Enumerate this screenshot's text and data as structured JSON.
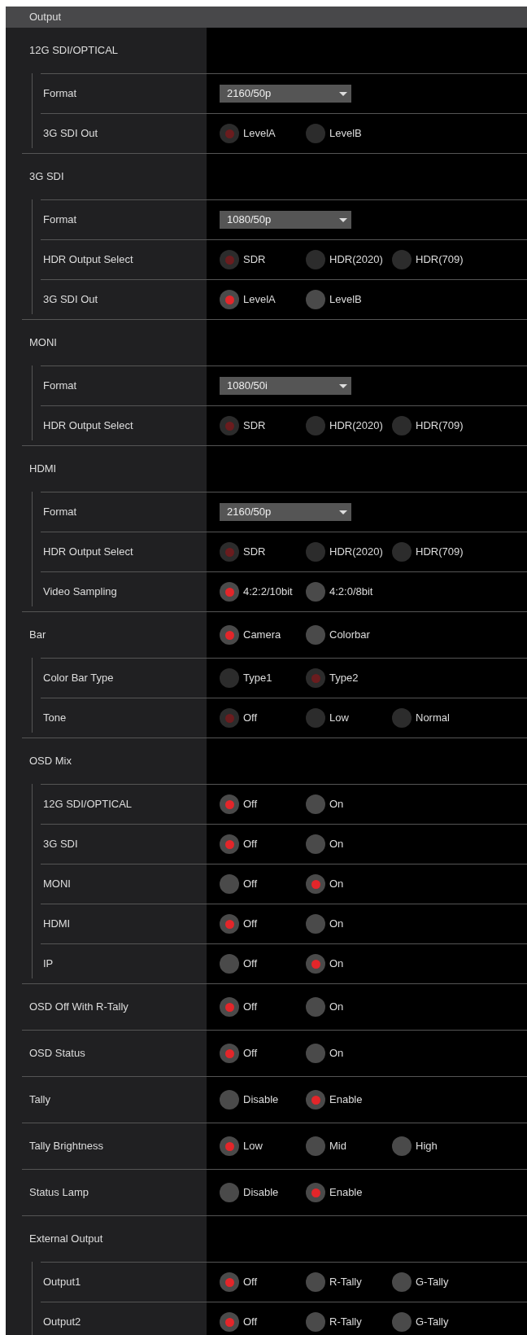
{
  "panel_title": "Output",
  "rows": [
    {
      "kind": "group",
      "label": "12G SDI/OPTICAL",
      "children": [
        {
          "kind": "select",
          "label": "Format",
          "value": "2160/50p"
        },
        {
          "kind": "radio",
          "label": "3G SDI Out",
          "disabled": true,
          "options": [
            {
              "label": "LevelA",
              "selected": true
            },
            {
              "label": "LevelB",
              "selected": false
            }
          ]
        }
      ]
    },
    {
      "kind": "group",
      "label": "3G SDI",
      "children": [
        {
          "kind": "select",
          "label": "Format",
          "value": "1080/50p"
        },
        {
          "kind": "radio",
          "label": "HDR Output Select",
          "disabled": true,
          "options": [
            {
              "label": "SDR",
              "selected": true
            },
            {
              "label": "HDR(2020)",
              "selected": false
            },
            {
              "label": "HDR(709)",
              "selected": false
            }
          ]
        },
        {
          "kind": "radio",
          "label": "3G SDI Out",
          "disabled": false,
          "options": [
            {
              "label": "LevelA",
              "selected": true
            },
            {
              "label": "LevelB",
              "selected": false
            }
          ]
        }
      ]
    },
    {
      "kind": "group",
      "label": "MONI",
      "children": [
        {
          "kind": "select",
          "label": "Format",
          "value": "1080/50i"
        },
        {
          "kind": "radio",
          "label": "HDR Output Select",
          "disabled": true,
          "options": [
            {
              "label": "SDR",
              "selected": true
            },
            {
              "label": "HDR(2020)",
              "selected": false
            },
            {
              "label": "HDR(709)",
              "selected": false
            }
          ]
        }
      ]
    },
    {
      "kind": "group",
      "label": "HDMI",
      "children": [
        {
          "kind": "select",
          "label": "Format",
          "value": "2160/50p"
        },
        {
          "kind": "radio",
          "label": "HDR Output Select",
          "disabled": true,
          "options": [
            {
              "label": "SDR",
              "selected": true
            },
            {
              "label": "HDR(2020)",
              "selected": false
            },
            {
              "label": "HDR(709)",
              "selected": false
            }
          ]
        },
        {
          "kind": "radio",
          "label": "Video Sampling",
          "disabled": false,
          "options": [
            {
              "label": "4:2:2/10bit",
              "selected": true
            },
            {
              "label": "4:2:0/8bit",
              "selected": false
            }
          ]
        }
      ]
    },
    {
      "kind": "group",
      "label": "Bar",
      "disabled": false,
      "options": [
        {
          "label": "Camera",
          "selected": true
        },
        {
          "label": "Colorbar",
          "selected": false
        }
      ],
      "children": [
        {
          "kind": "radio",
          "label": "Color Bar Type",
          "disabled": true,
          "options": [
            {
              "label": "Type1",
              "selected": false
            },
            {
              "label": "Type2",
              "selected": true
            }
          ]
        },
        {
          "kind": "radio",
          "label": "Tone",
          "disabled": true,
          "options": [
            {
              "label": "Off",
              "selected": true
            },
            {
              "label": "Low",
              "selected": false
            },
            {
              "label": "Normal",
              "selected": false
            }
          ]
        }
      ]
    },
    {
      "kind": "group",
      "label": "OSD Mix",
      "children": [
        {
          "kind": "radio",
          "label": "12G SDI/OPTICAL",
          "disabled": false,
          "options": [
            {
              "label": "Off",
              "selected": true
            },
            {
              "label": "On",
              "selected": false
            }
          ]
        },
        {
          "kind": "radio",
          "label": "3G SDI",
          "disabled": false,
          "options": [
            {
              "label": "Off",
              "selected": true
            },
            {
              "label": "On",
              "selected": false
            }
          ]
        },
        {
          "kind": "radio",
          "label": "MONI",
          "disabled": false,
          "options": [
            {
              "label": "Off",
              "selected": false
            },
            {
              "label": "On",
              "selected": true
            }
          ]
        },
        {
          "kind": "radio",
          "label": "HDMI",
          "disabled": false,
          "options": [
            {
              "label": "Off",
              "selected": true
            },
            {
              "label": "On",
              "selected": false
            }
          ]
        },
        {
          "kind": "radio",
          "label": "IP",
          "disabled": false,
          "options": [
            {
              "label": "Off",
              "selected": false
            },
            {
              "label": "On",
              "selected": true
            }
          ]
        }
      ]
    },
    {
      "kind": "radio",
      "label": "OSD Off With R-Tally",
      "disabled": false,
      "options": [
        {
          "label": "Off",
          "selected": true
        },
        {
          "label": "On",
          "selected": false
        }
      ]
    },
    {
      "kind": "radio",
      "label": "OSD Status",
      "disabled": false,
      "options": [
        {
          "label": "Off",
          "selected": true
        },
        {
          "label": "On",
          "selected": false
        }
      ]
    },
    {
      "kind": "radio",
      "label": "Tally",
      "disabled": false,
      "options": [
        {
          "label": "Disable",
          "selected": false
        },
        {
          "label": "Enable",
          "selected": true
        }
      ]
    },
    {
      "kind": "radio",
      "label": "Tally Brightness",
      "disabled": false,
      "options": [
        {
          "label": "Low",
          "selected": true
        },
        {
          "label": "Mid",
          "selected": false
        },
        {
          "label": "High",
          "selected": false
        }
      ]
    },
    {
      "kind": "radio",
      "label": "Status Lamp",
      "disabled": false,
      "options": [
        {
          "label": "Disable",
          "selected": false
        },
        {
          "label": "Enable",
          "selected": true
        }
      ]
    },
    {
      "kind": "group",
      "label": "External Output",
      "children": [
        {
          "kind": "radio",
          "label": "Output1",
          "disabled": false,
          "options": [
            {
              "label": "Off",
              "selected": true
            },
            {
              "label": "R-Tally",
              "selected": false
            },
            {
              "label": "G-Tally",
              "selected": false
            }
          ]
        },
        {
          "kind": "radio",
          "label": "Output2",
          "disabled": false,
          "options": [
            {
              "label": "Off",
              "selected": true
            },
            {
              "label": "R-Tally",
              "selected": false
            },
            {
              "label": "G-Tally",
              "selected": false
            }
          ]
        }
      ]
    }
  ]
}
